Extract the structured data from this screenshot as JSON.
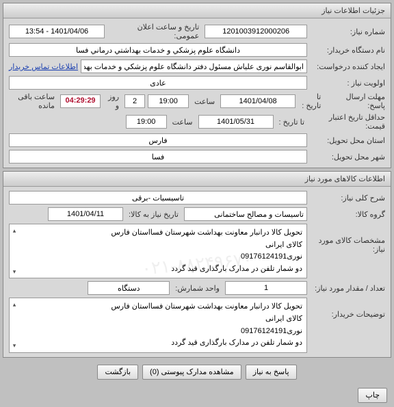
{
  "panel1": {
    "title": "جزئیات اطلاعات نیاز",
    "need_no_label": "شماره نیاز:",
    "need_no": "1201003912000206",
    "pub_date_label": "تاریخ و ساعت اعلان عمومی:",
    "pub_date": "1401/04/06 - 13:54",
    "buyer_label": "نام دستگاه خریدار:",
    "buyer_name": "دانشگاه علوم پزشکي و خدمات بهداشتي درماني فسا",
    "creator_label": "ایجاد کننده درخواست:",
    "creator_name": "ابوالقاسم نوری علیاش مسئول دفتر دانشگاه علوم پزشکي و خدمات بهداشتي د",
    "creator_link": "اطلاعات تماس خریدار",
    "priority_label": "اولویت نیاز :",
    "priority": "عادی",
    "deadline_label": "مهلت ارسال پاسخ:",
    "to_date_label": "تا تاریخ :",
    "to_date": "1401/04/08",
    "time_label": "ساعت",
    "to_time": "19:00",
    "remain_days": "2",
    "remain_days_label": "روز و",
    "remain_time": "04:29:29",
    "remain_suffix": "ساعت باقی مانده",
    "valid_label": "حداقل تاریخ اعتبار قیمت:",
    "valid_to_date": "1401/05/31",
    "valid_to_time": "19:00",
    "province_label": "استان محل تحویل:",
    "province": "فارس",
    "city_label": "شهر محل تحویل:",
    "city": "فسا"
  },
  "panel2": {
    "title": "اطلاعات کالاهای مورد نیاز",
    "desc_label": "شرح کلی نیاز:",
    "desc": "تاسیسیات -برقی",
    "group_label": "گروه کالا:",
    "group": "تاسیسات و مصالح ساختمانی",
    "need_item_date_label": "تاریخ نیاز به کالا:",
    "need_item_date": "1401/04/11",
    "spec_label": "مشخصات کالای مورد نیاز:",
    "spec_line1": "تحویل کالا درانبار معاونت بهداشت شهرستان فسااستان فارس",
    "spec_line2": "کالای ایرانی",
    "spec_line3": "نوری09176124191",
    "spec_line4": "دو شمار تلفن در مدارک بارگذاری قید گردد",
    "qty_label": "تعداد / مقدار مورد نیاز:",
    "qty": "1",
    "unit_label": "واحد شمارش:",
    "unit": "دستگاه",
    "buyer_notes_label": "توضیحات خریدار:",
    "buyer_notes_line1": "تحویل کالا درانبار معاونت بهداشت شهرستان فسااستان فارس",
    "buyer_notes_line2": "کالای ایرانی",
    "buyer_notes_line3": "نوری09176124191",
    "buyer_notes_line4": "دو شمار تلفن در مدارک بارگذاری قید گردد",
    "watermark": "۰۲۱-۸۸۲۴۹۶۷۰"
  },
  "buttons": {
    "reply": "پاسخ به نیاز",
    "attachments": "مشاهده مدارک پیوستی",
    "attachments_count": "(0)",
    "back": "بازگشت",
    "print": "چاپ"
  }
}
